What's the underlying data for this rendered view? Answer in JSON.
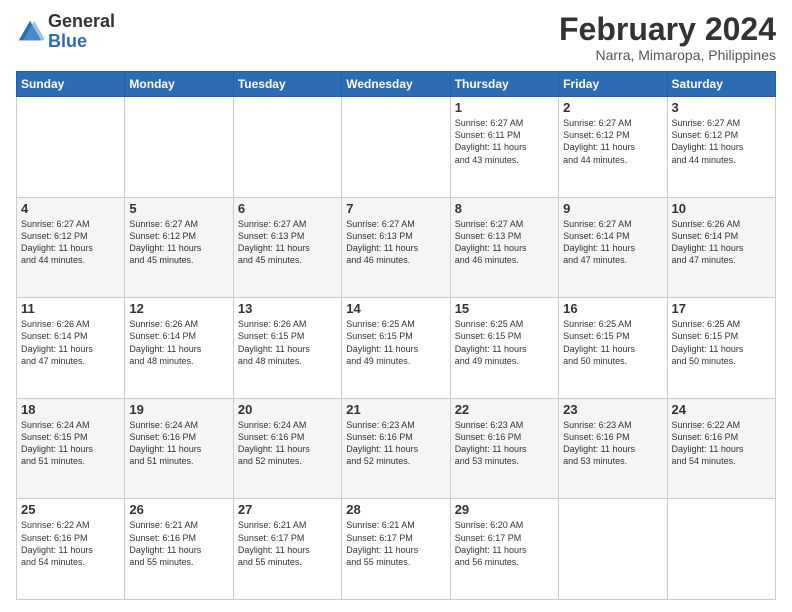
{
  "header": {
    "logo_general": "General",
    "logo_blue": "Blue",
    "month_title": "February 2024",
    "location": "Narra, Mimaropa, Philippines"
  },
  "days_of_week": [
    "Sunday",
    "Monday",
    "Tuesday",
    "Wednesday",
    "Thursday",
    "Friday",
    "Saturday"
  ],
  "weeks": [
    [
      {
        "num": "",
        "info": ""
      },
      {
        "num": "",
        "info": ""
      },
      {
        "num": "",
        "info": ""
      },
      {
        "num": "",
        "info": ""
      },
      {
        "num": "1",
        "info": "Sunrise: 6:27 AM\nSunset: 6:11 PM\nDaylight: 11 hours\nand 43 minutes."
      },
      {
        "num": "2",
        "info": "Sunrise: 6:27 AM\nSunset: 6:12 PM\nDaylight: 11 hours\nand 44 minutes."
      },
      {
        "num": "3",
        "info": "Sunrise: 6:27 AM\nSunset: 6:12 PM\nDaylight: 11 hours\nand 44 minutes."
      }
    ],
    [
      {
        "num": "4",
        "info": "Sunrise: 6:27 AM\nSunset: 6:12 PM\nDaylight: 11 hours\nand 44 minutes."
      },
      {
        "num": "5",
        "info": "Sunrise: 6:27 AM\nSunset: 6:12 PM\nDaylight: 11 hours\nand 45 minutes."
      },
      {
        "num": "6",
        "info": "Sunrise: 6:27 AM\nSunset: 6:13 PM\nDaylight: 11 hours\nand 45 minutes."
      },
      {
        "num": "7",
        "info": "Sunrise: 6:27 AM\nSunset: 6:13 PM\nDaylight: 11 hours\nand 46 minutes."
      },
      {
        "num": "8",
        "info": "Sunrise: 6:27 AM\nSunset: 6:13 PM\nDaylight: 11 hours\nand 46 minutes."
      },
      {
        "num": "9",
        "info": "Sunrise: 6:27 AM\nSunset: 6:14 PM\nDaylight: 11 hours\nand 47 minutes."
      },
      {
        "num": "10",
        "info": "Sunrise: 6:26 AM\nSunset: 6:14 PM\nDaylight: 11 hours\nand 47 minutes."
      }
    ],
    [
      {
        "num": "11",
        "info": "Sunrise: 6:26 AM\nSunset: 6:14 PM\nDaylight: 11 hours\nand 47 minutes."
      },
      {
        "num": "12",
        "info": "Sunrise: 6:26 AM\nSunset: 6:14 PM\nDaylight: 11 hours\nand 48 minutes."
      },
      {
        "num": "13",
        "info": "Sunrise: 6:26 AM\nSunset: 6:15 PM\nDaylight: 11 hours\nand 48 minutes."
      },
      {
        "num": "14",
        "info": "Sunrise: 6:25 AM\nSunset: 6:15 PM\nDaylight: 11 hours\nand 49 minutes."
      },
      {
        "num": "15",
        "info": "Sunrise: 6:25 AM\nSunset: 6:15 PM\nDaylight: 11 hours\nand 49 minutes."
      },
      {
        "num": "16",
        "info": "Sunrise: 6:25 AM\nSunset: 6:15 PM\nDaylight: 11 hours\nand 50 minutes."
      },
      {
        "num": "17",
        "info": "Sunrise: 6:25 AM\nSunset: 6:15 PM\nDaylight: 11 hours\nand 50 minutes."
      }
    ],
    [
      {
        "num": "18",
        "info": "Sunrise: 6:24 AM\nSunset: 6:15 PM\nDaylight: 11 hours\nand 51 minutes."
      },
      {
        "num": "19",
        "info": "Sunrise: 6:24 AM\nSunset: 6:16 PM\nDaylight: 11 hours\nand 51 minutes."
      },
      {
        "num": "20",
        "info": "Sunrise: 6:24 AM\nSunset: 6:16 PM\nDaylight: 11 hours\nand 52 minutes."
      },
      {
        "num": "21",
        "info": "Sunrise: 6:23 AM\nSunset: 6:16 PM\nDaylight: 11 hours\nand 52 minutes."
      },
      {
        "num": "22",
        "info": "Sunrise: 6:23 AM\nSunset: 6:16 PM\nDaylight: 11 hours\nand 53 minutes."
      },
      {
        "num": "23",
        "info": "Sunrise: 6:23 AM\nSunset: 6:16 PM\nDaylight: 11 hours\nand 53 minutes."
      },
      {
        "num": "24",
        "info": "Sunrise: 6:22 AM\nSunset: 6:16 PM\nDaylight: 11 hours\nand 54 minutes."
      }
    ],
    [
      {
        "num": "25",
        "info": "Sunrise: 6:22 AM\nSunset: 6:16 PM\nDaylight: 11 hours\nand 54 minutes."
      },
      {
        "num": "26",
        "info": "Sunrise: 6:21 AM\nSunset: 6:16 PM\nDaylight: 11 hours\nand 55 minutes."
      },
      {
        "num": "27",
        "info": "Sunrise: 6:21 AM\nSunset: 6:17 PM\nDaylight: 11 hours\nand 55 minutes."
      },
      {
        "num": "28",
        "info": "Sunrise: 6:21 AM\nSunset: 6:17 PM\nDaylight: 11 hours\nand 55 minutes."
      },
      {
        "num": "29",
        "info": "Sunrise: 6:20 AM\nSunset: 6:17 PM\nDaylight: 11 hours\nand 56 minutes."
      },
      {
        "num": "",
        "info": ""
      },
      {
        "num": "",
        "info": ""
      }
    ]
  ]
}
